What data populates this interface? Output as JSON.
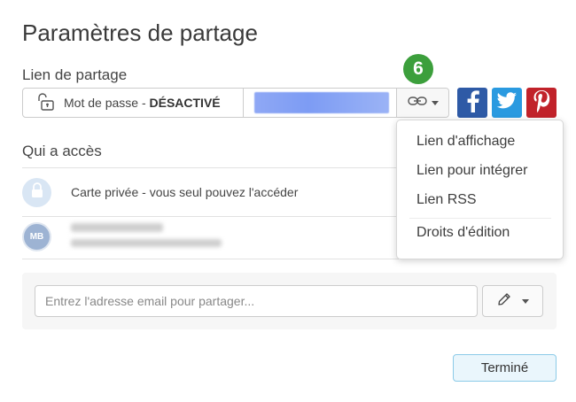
{
  "title": "Paramètres de partage",
  "share_link": {
    "label": "Lien de partage",
    "password_prefix": "Mot de passe - ",
    "password_state": "DÉSACTIVÉ",
    "step_badge": "6"
  },
  "access": {
    "label": "Qui a accès",
    "private_text": "Carte privée - vous seul pouvez l'accéder",
    "user_initials": "MB"
  },
  "email": {
    "placeholder": "Entrez l'adresse email pour partager..."
  },
  "done_label": "Terminé",
  "link_menu": {
    "items": [
      "Lien d'affichage",
      "Lien pour intégrer",
      "Lien RSS",
      "Droits d'édition"
    ]
  },
  "colors": {
    "facebook": "#2e5aa6",
    "twitter": "#2a9ae0",
    "pinterest": "#c1222a",
    "badge": "#3c9f3c"
  },
  "icons": [
    "lock-icon",
    "link-icon",
    "facebook-icon",
    "twitter-icon",
    "pinterest-icon",
    "pencil-icon"
  ]
}
